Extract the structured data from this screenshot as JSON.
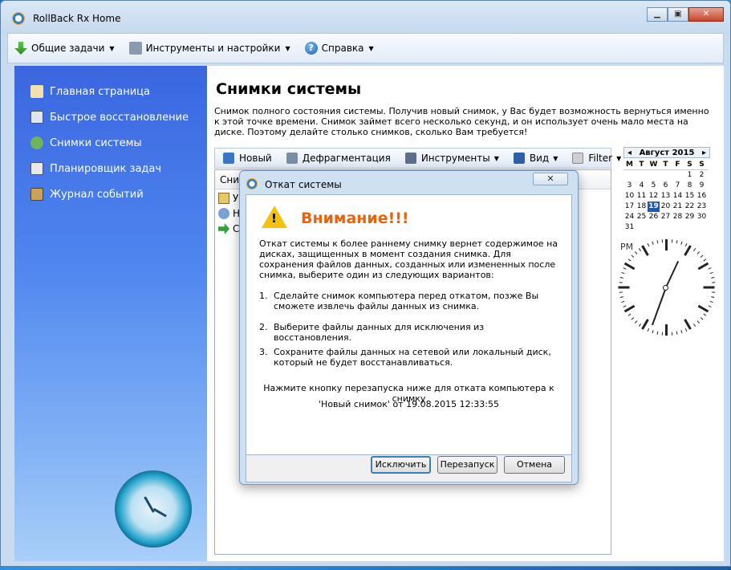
{
  "window": {
    "title": "RollBack Rx Home",
    "minimize_glyph": "▁",
    "maximize_glyph": "▣",
    "close_glyph": "✕"
  },
  "menubar": {
    "items": [
      {
        "label": "Общие задачи",
        "icon": "download-arrow-icon"
      },
      {
        "label": "Инструменты и настройки",
        "icon": "tools-icon"
      },
      {
        "label": "Справка",
        "icon": "help-icon"
      }
    ]
  },
  "sidebar": {
    "items": [
      {
        "label": "Главная страница",
        "icon": "home-icon"
      },
      {
        "label": "Быстрое восстановление",
        "icon": "monitor-icon"
      },
      {
        "label": "Снимки системы",
        "icon": "snapshot-icon"
      },
      {
        "label": "Планировщик задач",
        "icon": "scheduler-icon"
      },
      {
        "label": "Журнал событий",
        "icon": "log-icon"
      }
    ]
  },
  "main": {
    "title": "Снимки системы",
    "description": "Снимок полного состояния системы. Получив новый снимок, у Вас будет возможность вернуться именно к этой точке времени. Снимок займет всего несколько секунд, и он использует очень мало места на диске. Поэтому делайте столько снимков, сколько Вам требуется!",
    "toolbar": {
      "items": [
        {
          "label": "Новый",
          "icon": "new-snapshot-icon",
          "dropdown": false
        },
        {
          "label": "Дефрагментация",
          "icon": "defrag-icon",
          "dropdown": false
        },
        {
          "label": "Инструменты",
          "icon": "tools-icon",
          "dropdown": true
        },
        {
          "label": "Вид",
          "icon": "view-icon",
          "dropdown": true
        },
        {
          "label": "Filter",
          "icon": "filter-icon",
          "dropdown": true
        }
      ]
    },
    "list": {
      "header": "Сни",
      "rows": [
        {
          "text": "У",
          "icon": "lock-folder-icon"
        },
        {
          "text": "Н",
          "icon": "user-icon"
        },
        {
          "text": "С",
          "icon": "green-arrow-icon"
        }
      ]
    }
  },
  "calendar": {
    "month_label": "Август 2015",
    "prev": "◂",
    "next": "▸",
    "weekdays": [
      "M",
      "T",
      "W",
      "T",
      "F",
      "S",
      "S"
    ],
    "days": [
      "",
      "",
      "",
      "",
      "",
      "1",
      "2",
      "3",
      "4",
      "5",
      "6",
      "7",
      "8",
      "9",
      "10",
      "11",
      "12",
      "13",
      "14",
      "15",
      "16",
      "17",
      "18",
      "19",
      "20",
      "21",
      "22",
      "23",
      "24",
      "25",
      "26",
      "27",
      "28",
      "29",
      "30",
      "31",
      "",
      "",
      "",
      "",
      "",
      ""
    ],
    "today": "19"
  },
  "clock": {
    "period": "PM"
  },
  "dialog": {
    "title": "Откат системы",
    "close_glyph": "✕",
    "warning_title": "Внимание!!!",
    "intro": "Откат системы к более раннему снимку вернет содержимое на дисках, защищенных в момент создания снимка. Для сохранения файлов данных, созданных или измененных после снимка, выберите один из следующих вариантов:",
    "options": [
      {
        "num": "1.",
        "text": "Сделайте снимок компьютера перед откатом, позже Вы сможете извлечь файлы данных из снимка."
      },
      {
        "num": "2.",
        "text": "Выберите файлы данных для исключения из восстановления."
      },
      {
        "num": "3.",
        "text": "Сохраните файлы данных на сетевой или локальный диск, который не будет восстанавливаться."
      }
    ],
    "prompt": "Нажмите кнопку перезапуска ниже для отката компьютера к снимку",
    "snapshot_ref": "'Новый снимок' от 19.08.2015 12:33:55",
    "buttons": {
      "exclude": "Исключить",
      "restart": "Перезапуск",
      "cancel": "Отмена"
    }
  }
}
